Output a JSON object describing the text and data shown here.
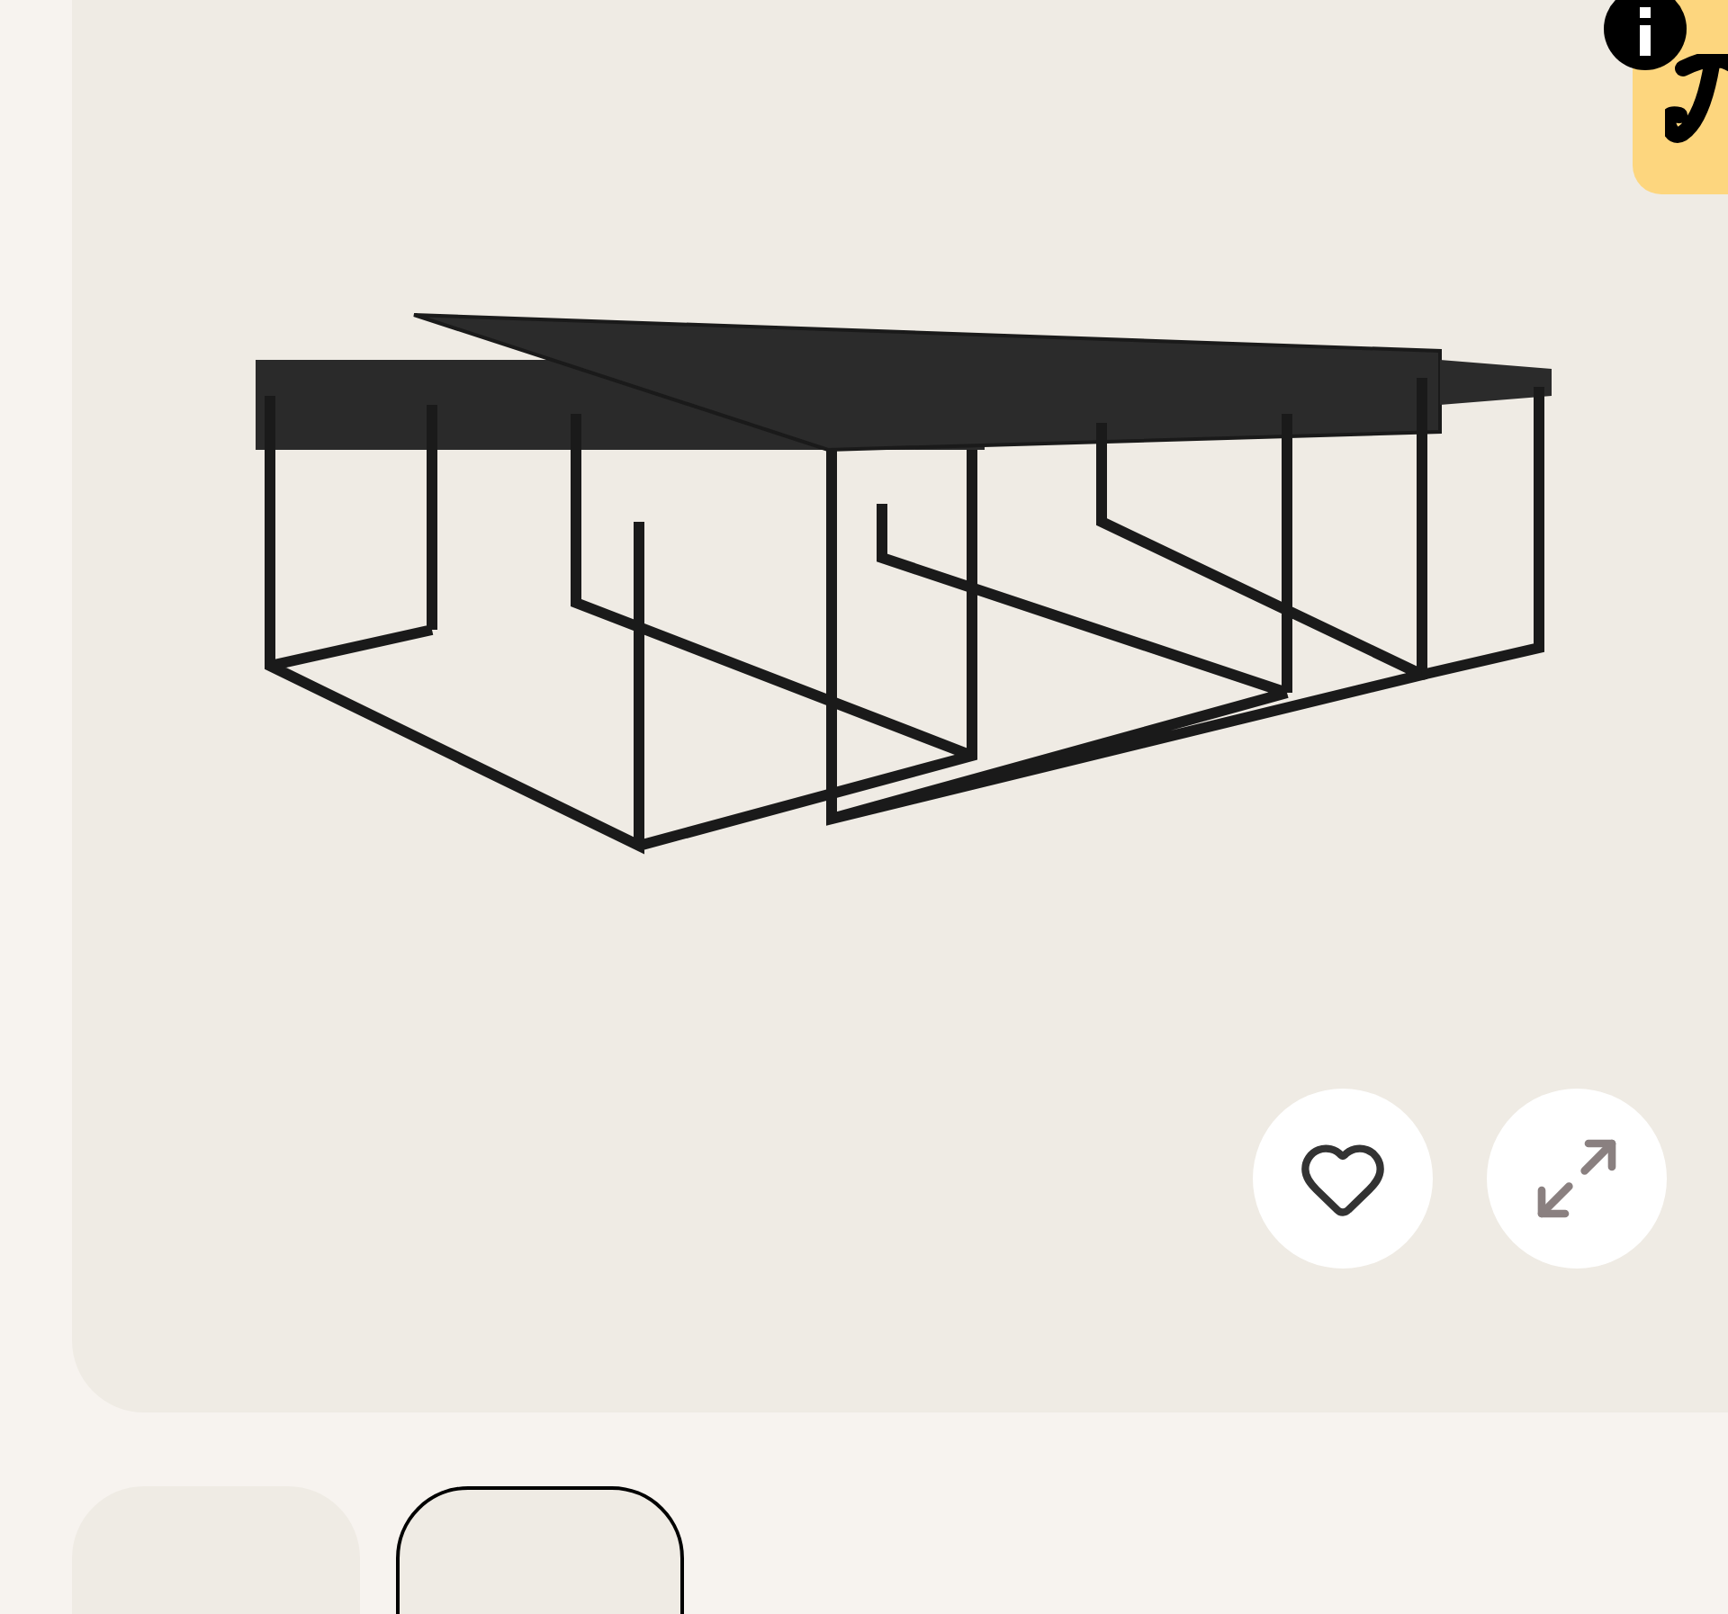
{
  "gallery": {
    "thumbnails": [
      {
        "selected": false
      },
      {
        "selected": true
      }
    ]
  }
}
